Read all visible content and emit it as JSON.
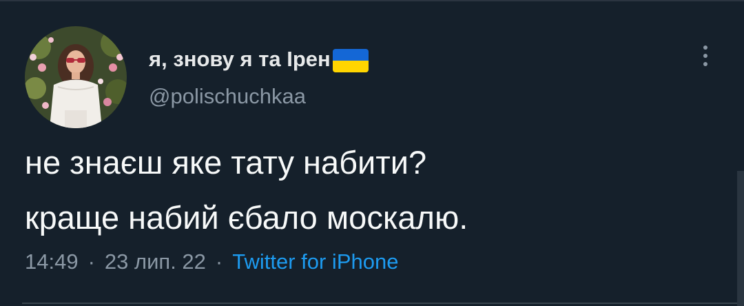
{
  "tweet": {
    "author": {
      "display_name": "я, знову я та Ірен",
      "flag_colors": {
        "top": "#1467d6",
        "bottom": "#ffd500"
      },
      "handle": "@polischuchkaa"
    },
    "text_lines": [
      "не знаєш яке тату набити?",
      "краще набий єбало москалю."
    ],
    "time": "14:49",
    "date": "23 лип. 22",
    "separator": "·",
    "source": "Twitter for iPhone"
  },
  "colors": {
    "background": "#15202b",
    "primary_text": "#f7f9f9",
    "secondary_text": "#8b98a5",
    "accent": "#1d9bf0"
  }
}
